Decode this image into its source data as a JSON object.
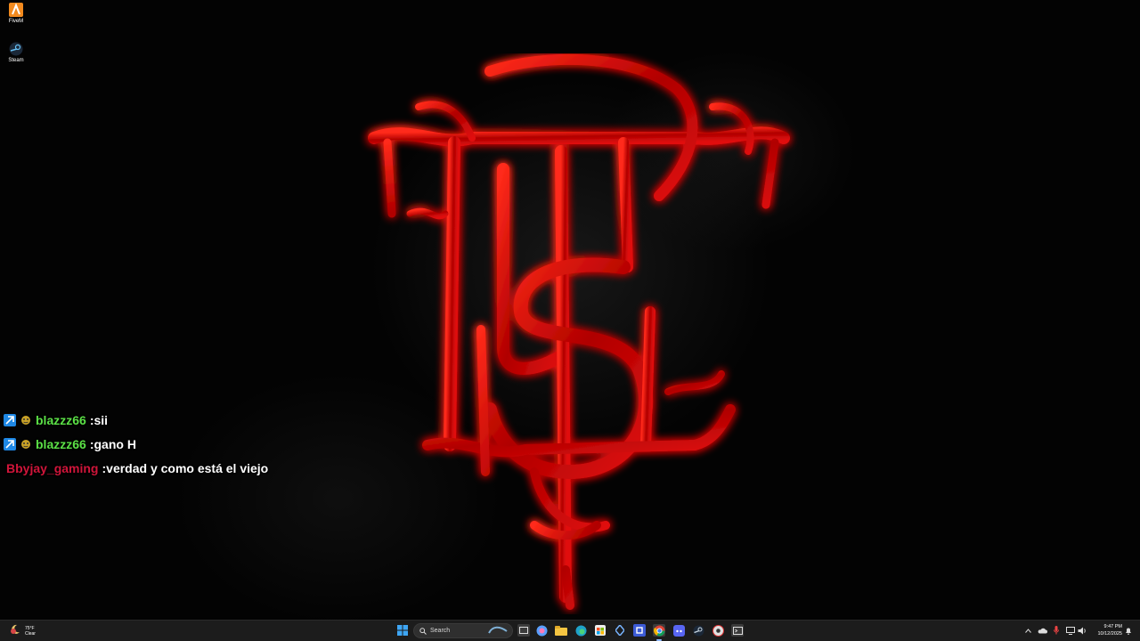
{
  "desktop": {
    "icons": [
      {
        "label": "FiveM",
        "icon": "fivem-icon"
      },
      {
        "label": "Steam",
        "icon": "steam-icon"
      }
    ]
  },
  "chat": {
    "messages": [
      {
        "user": "blazzz66",
        "sep": " : ",
        "text": "sii",
        "color": "#5be046"
      },
      {
        "user": "blazzz66",
        "sep": " : ",
        "text": "gano H",
        "color": "#5be046"
      },
      {
        "user": "Bbyjay_gaming",
        "sep": " : ",
        "text": "verdad y como está el viejo",
        "color": "#d0153a"
      }
    ]
  },
  "taskbar": {
    "weather": {
      "temp": "75°F",
      "condition": "Clear"
    },
    "search_label": "Search",
    "clock": {
      "time": "9:47 PM",
      "date": "10/12/2025"
    }
  },
  "colors": {
    "logo_red": "#d40000",
    "taskbar_bg": "#1c1c1c",
    "chat_green": "#5be046",
    "chat_red": "#d0153a"
  }
}
